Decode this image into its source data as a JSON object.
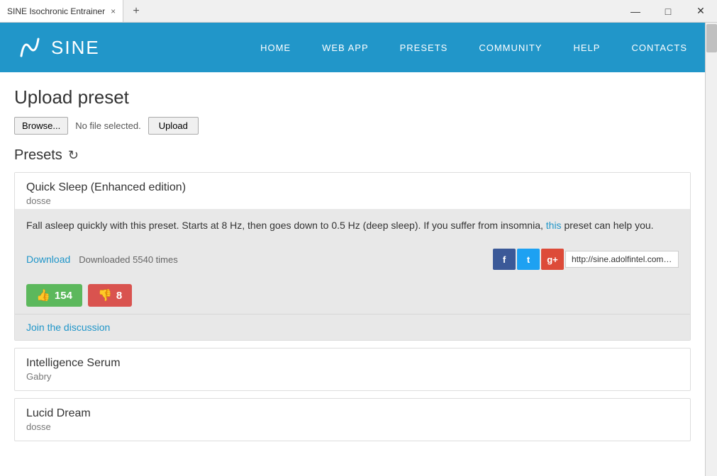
{
  "titlebar": {
    "tab_label": "SINE Isochronic Entrainer",
    "close_tab": "×",
    "new_tab": "+",
    "minimize": "—",
    "maximize": "□",
    "close_window": "✕"
  },
  "navbar": {
    "brand": "SINE",
    "links": [
      {
        "id": "home",
        "label": "HOME"
      },
      {
        "id": "webapp",
        "label": "WEB APP"
      },
      {
        "id": "presets",
        "label": "PRESETS"
      },
      {
        "id": "community",
        "label": "COMMUNITY"
      },
      {
        "id": "help",
        "label": "HELP"
      },
      {
        "id": "contacts",
        "label": "CONTACTS"
      }
    ]
  },
  "page": {
    "title": "Upload preset",
    "upload": {
      "browse_label": "Browse...",
      "no_file_label": "No file selected.",
      "upload_label": "Upload"
    },
    "presets_heading": "Presets",
    "refresh_icon": "↻",
    "preset_cards": [
      {
        "id": "quick-sleep",
        "title": "Quick Sleep (Enhanced edition)",
        "author": "dosse",
        "description_parts": [
          {
            "text": "Fall asleep quickly with this preset. Starts at 8 Hz, then goes down to 0.5 Hz (deep sleep). If you suffer from insomnia, ",
            "type": "plain"
          },
          {
            "text": "this",
            "type": "link",
            "href": "#"
          },
          {
            "text": " preset can help you.",
            "type": "plain"
          }
        ],
        "download_label": "Download",
        "downloaded_count": "Downloaded 5540 times",
        "share_url": "http://sine.adolfintel.com/gc",
        "like_count": "154",
        "dislike_count": "8",
        "join_discussion_label": "Join the discussion"
      }
    ],
    "simple_cards": [
      {
        "id": "intelligence-serum",
        "title": "Intelligence Serum",
        "author": "Gabry"
      },
      {
        "id": "lucid-dream",
        "title": "Lucid Dream",
        "author": "dosse"
      }
    ]
  }
}
